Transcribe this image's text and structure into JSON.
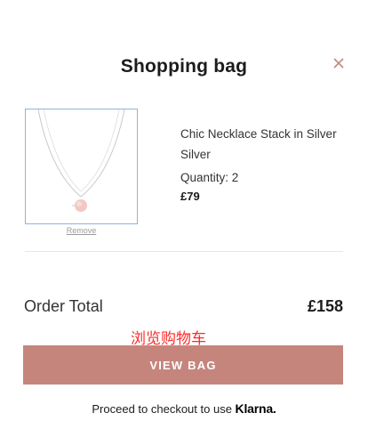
{
  "header": {
    "title": "Shopping bag",
    "close_icon": "close-icon"
  },
  "item": {
    "name": "Chic Necklace Stack in Silver",
    "variant": "Silver",
    "quantity": "Quantity: 2",
    "price": "£79",
    "remove_label": "Remove",
    "image_icon": "necklace-image"
  },
  "summary": {
    "total_label": "Order Total",
    "total_value": "£158"
  },
  "overlay_text": "浏览购物车",
  "actions": {
    "view_bag_label": "VIEW BAG",
    "checkout_text": "Proceed to checkout to use",
    "klarna_label": "Klarna."
  },
  "colors": {
    "accent": "#c5857d",
    "close": "#c5857d",
    "overlay": "#ff2a2a"
  }
}
